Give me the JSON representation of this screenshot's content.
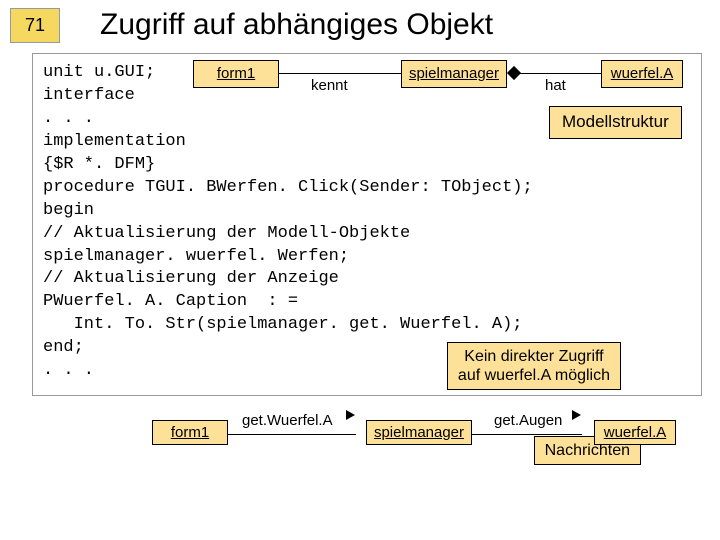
{
  "slide": {
    "number": "71",
    "title": "Zugriff auf abhängiges Objekt"
  },
  "diagram_top": {
    "form": "form1",
    "spielmanager": "spielmanager",
    "wuerfel": "wuerfel.A",
    "kennt": "kennt",
    "hat": "hat",
    "modellstruktur": "Modellstruktur"
  },
  "code": {
    "l1": "unit u.GUI;",
    "l2": "",
    "l3": "interface",
    "l4": "",
    "l5": ". . .",
    "l6": "",
    "l7": "implementation",
    "l8": "",
    "l9": "{$R *. DFM}",
    "l10": "",
    "l11": "procedure TGUI. BWerfen. Click(Sender: TObject);",
    "l12": "begin",
    "l13": "// Aktualisierung der Modell-Objekte",
    "l14": "spielmanager. wuerfel. Werfen;",
    "l15": "// Aktualisierung der Anzeige",
    "l16": "PWuerfel. A. Caption  : =",
    "l17": "   Int. To. Str(spielmanager. get. Wuerfel. A);",
    "l18": "end;",
    "l19": "",
    "l20": ". . ."
  },
  "callouts": {
    "kein_direkt_1": "Kein direkter Zugriff",
    "kein_direkt_2": "auf wuerfel.A möglich",
    "nachrichten": "Nachrichten"
  },
  "diagram_bottom": {
    "form": "form1",
    "msg1": "get.Wuerfel.A",
    "spielmanager": "spielmanager",
    "msg2": "get.Augen",
    "wuerfel": "wuerfel.A"
  }
}
